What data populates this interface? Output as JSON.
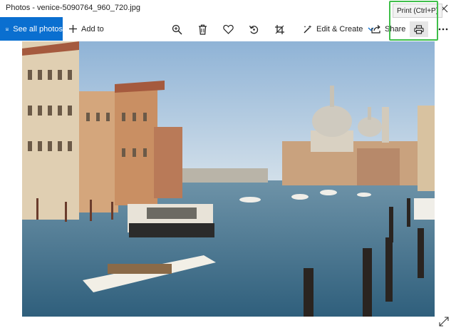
{
  "window": {
    "title": "Photos - venice-5090764_960_720.jpg",
    "close_icon": "close-icon"
  },
  "toolbar": {
    "see_all_label": "See all photos",
    "add_to_label": "Add to",
    "edit_create_label": "Edit & Create",
    "share_label": "Share",
    "print_tooltip": "Print (Ctrl+P)",
    "icons": [
      "photos-icon",
      "plus-icon",
      "zoom-in-icon",
      "trash-icon",
      "heart-icon",
      "rotate-icon",
      "crop-icon",
      "edit-create-icon",
      "chevron-down-icon",
      "share-icon",
      "print-icon",
      "more-icon"
    ]
  },
  "photo": {
    "subject": "Grand Canal, Venice",
    "expand_icon": "expand-icon"
  },
  "colors": {
    "accent": "#0a6fd0",
    "highlight": "#3fbf4a",
    "sky": "#9cbbd9",
    "water": "#3f6f8a"
  }
}
